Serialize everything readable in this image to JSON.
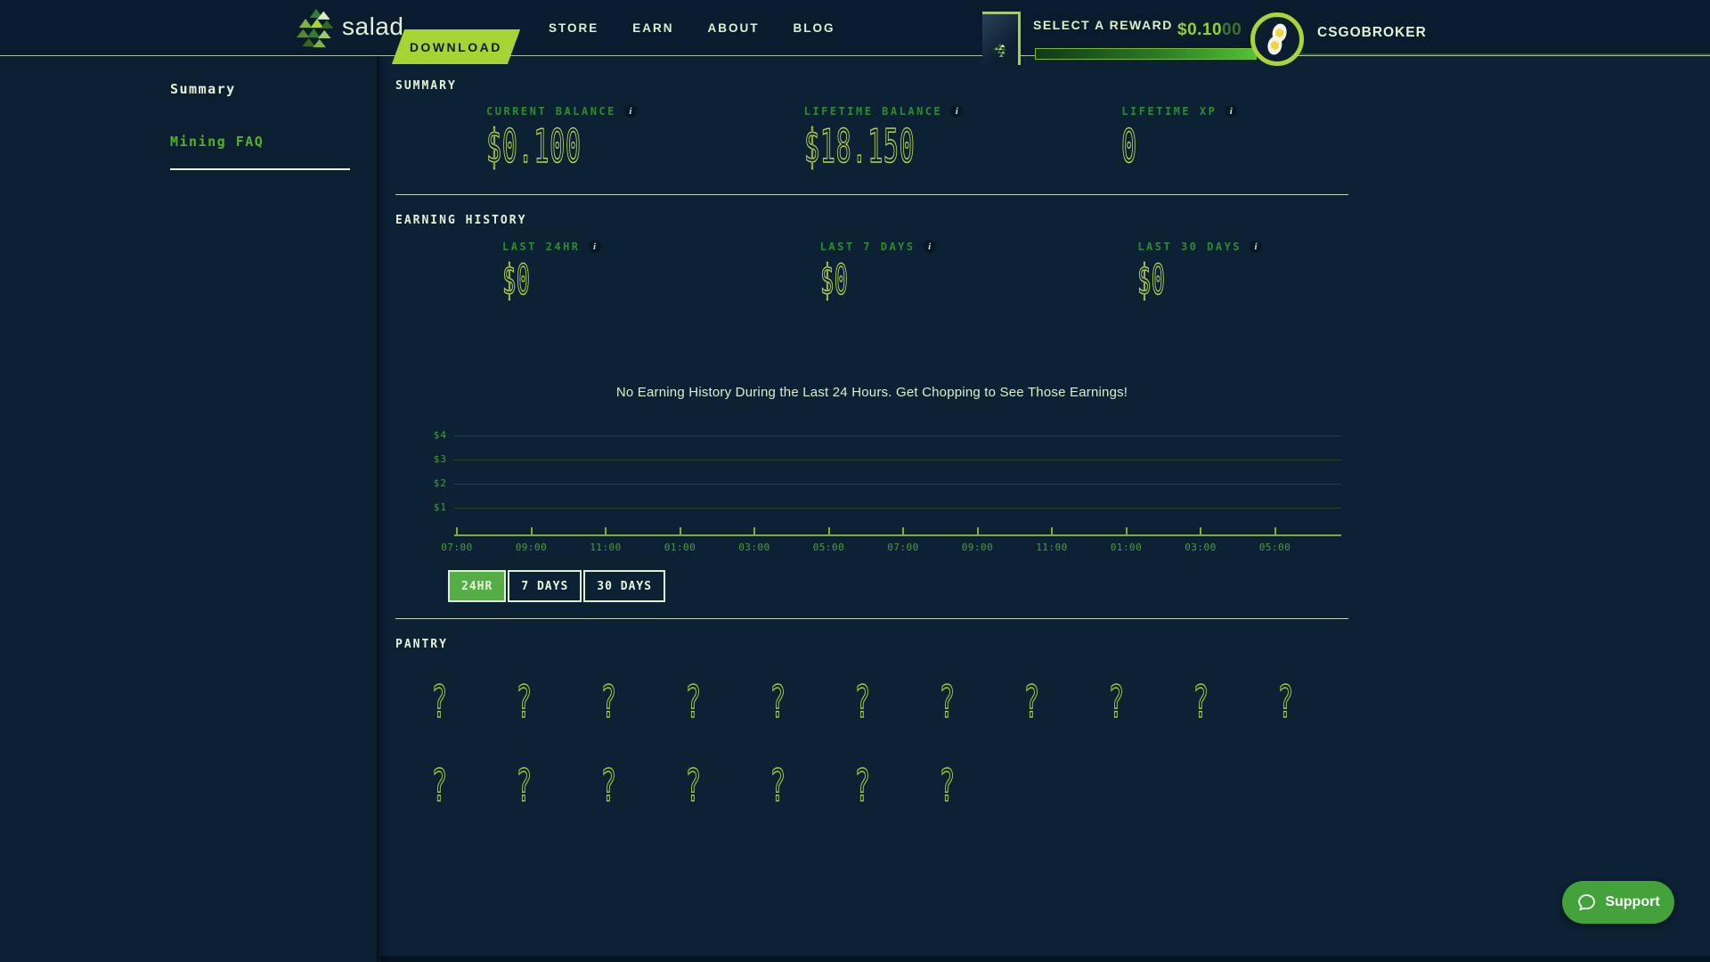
{
  "header": {
    "logo_text": "salad",
    "download_label": "DOWNLOAD",
    "nav": [
      {
        "label": "STORE"
      },
      {
        "label": "EARN"
      },
      {
        "label": "ABOUT"
      },
      {
        "label": "BLOG"
      }
    ],
    "select_reward_label": "SELECT A REWARD",
    "balance_main": "$0.10",
    "balance_sub": "00",
    "username": "CSGOBROKER"
  },
  "sidebar": {
    "items": [
      {
        "label": "Summary",
        "active": true
      },
      {
        "label": "Mining FAQ",
        "active": false
      }
    ]
  },
  "summary": {
    "heading": "SUMMARY",
    "stats": [
      {
        "label": "CURRENT BALANCE",
        "value": "$0.100"
      },
      {
        "label": "LIFETIME BALANCE",
        "value": "$18.150"
      },
      {
        "label": "LIFETIME XP",
        "value": "0"
      }
    ]
  },
  "earning_history": {
    "heading": "EARNING HISTORY",
    "stats": [
      {
        "label": "LAST 24HR",
        "value": "$0"
      },
      {
        "label": "LAST 7 DAYS",
        "value": "$0"
      },
      {
        "label": "LAST 30 DAYS",
        "value": "$0"
      }
    ],
    "empty_message": "No Earning History During the Last 24 Hours. Get Chopping to See Those Earnings!",
    "range_buttons": [
      {
        "label": "24HR",
        "active": true
      },
      {
        "label": "7 DAYS",
        "active": false
      },
      {
        "label": "30 DAYS",
        "active": false
      }
    ]
  },
  "chart_data": {
    "type": "line",
    "title": "",
    "series": [],
    "y_ticks": [
      "$4",
      "$3",
      "$2",
      "$1"
    ],
    "ylim": [
      0,
      4
    ],
    "x_ticks": [
      "07:00",
      "09:00",
      "11:00",
      "01:00",
      "03:00",
      "05:00",
      "07:00",
      "09:00",
      "11:00",
      "01:00",
      "03:00",
      "05:00"
    ],
    "grid": true,
    "note": "empty chart - no earnings in selected 24HR range"
  },
  "pantry": {
    "heading": "PANTRY",
    "placeholder_glyph": "?",
    "row_counts": [
      11,
      7
    ]
  },
  "support": {
    "label": "Support"
  },
  "icons": {
    "info_glyph": "i"
  },
  "colors": {
    "header_bg": "#0a1b2d",
    "page_bg": "#0c2134",
    "brand_green": "#a6d435",
    "label_green": "#2e8b2e",
    "value_outline_green": "#b9d44e",
    "cream": "#e6f2d6",
    "progress_bright": "#4fc236",
    "support_green": "#44a23b"
  }
}
